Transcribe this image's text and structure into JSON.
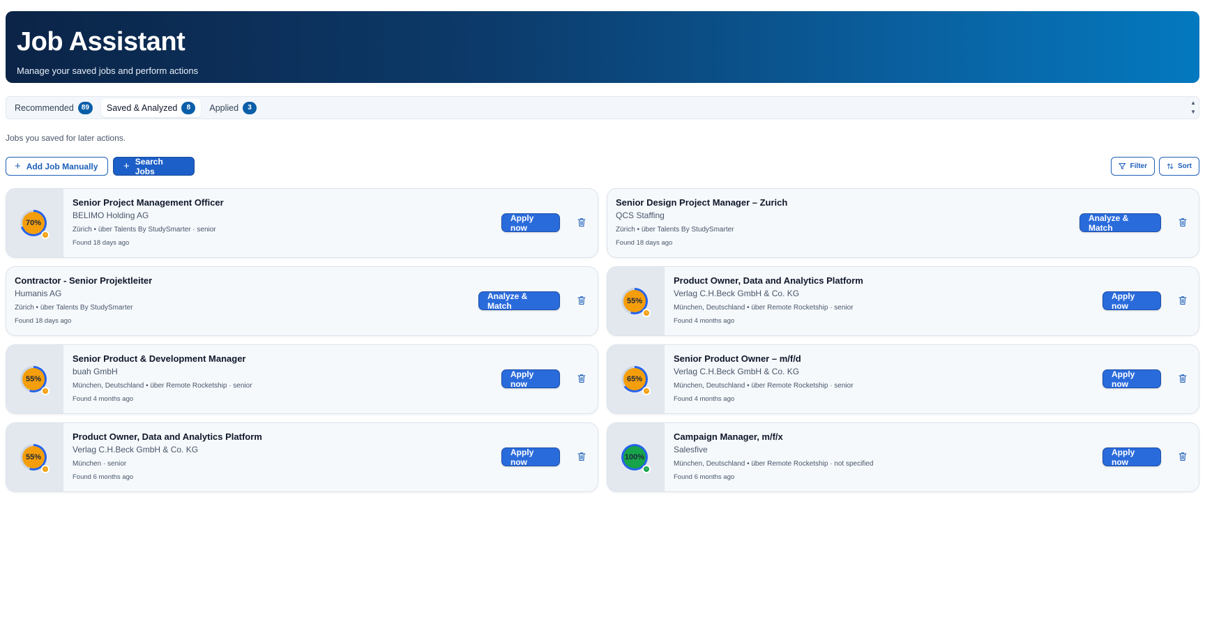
{
  "header": {
    "title": "Job Assistant",
    "subtitle": "Manage your saved jobs and perform actions"
  },
  "tabs": [
    {
      "label": "Recommended",
      "count": "89"
    },
    {
      "label": "Saved & Analyzed",
      "count": "8"
    },
    {
      "label": "Applied",
      "count": "3"
    }
  ],
  "active_tab": "Saved & Analyzed",
  "section_description": "Jobs you saved for later actions.",
  "toolbar": {
    "add_manual_label": "Add Job Manually",
    "search_jobs_label": "Search Jobs",
    "filter_label": "Filter",
    "sort_label": "Sort"
  },
  "colors": {
    "accent": "#1d5fc8",
    "match_medium": "#f59e0b",
    "match_high": "#16a34a"
  },
  "jobs": [
    {
      "title": "Senior Project Management Officer",
      "company": "BELIMO Holding AG",
      "meta": "Zürich • über Talents By StudySmarter · senior",
      "found": "Found 18 days ago",
      "score": "70%",
      "action": "Apply now"
    },
    {
      "title": "Senior Design Project Manager – Zurich",
      "company": "QCS Staffing",
      "meta": "Zürich • über Talents By StudySmarter",
      "found": "Found 18 days ago",
      "score": "",
      "action": "Analyze & Match"
    },
    {
      "title": "Contractor - Senior Projektleiter",
      "company": "Humanis AG",
      "meta": "Zürich • über Talents By StudySmarter",
      "found": "Found 18 days ago",
      "score": "",
      "action": "Analyze & Match"
    },
    {
      "title": "Product Owner, Data and Analytics Platform",
      "company": "Verlag C.H.Beck GmbH & Co. KG",
      "meta": "München, Deutschland • über Remote Rocketship · senior",
      "found": "Found 4 months ago",
      "score": "55%",
      "action": "Apply now"
    },
    {
      "title": "Senior Product & Development Manager",
      "company": "buah GmbH",
      "meta": "München, Deutschland • über Remote Rocketship · senior",
      "found": "Found 4 months ago",
      "score": "55%",
      "action": "Apply now"
    },
    {
      "title": "Senior Product Owner – m/f/d",
      "company": "Verlag C.H.Beck GmbH & Co. KG",
      "meta": "München, Deutschland • über Remote Rocketship · senior",
      "found": "Found 4 months ago",
      "score": "65%",
      "action": "Apply now"
    },
    {
      "title": "Product Owner, Data and Analytics Platform",
      "company": "Verlag C.H.Beck GmbH & Co. KG",
      "meta": "München · senior",
      "found": "Found 6 months ago",
      "score": "55%",
      "action": "Apply now"
    },
    {
      "title": "Campaign Manager, m/f/x",
      "company": "Salesfive",
      "meta": "München, Deutschland • über Remote Rocketship · not specified",
      "found": "Found 6 months ago",
      "score": "100%",
      "action": "Apply now"
    }
  ]
}
